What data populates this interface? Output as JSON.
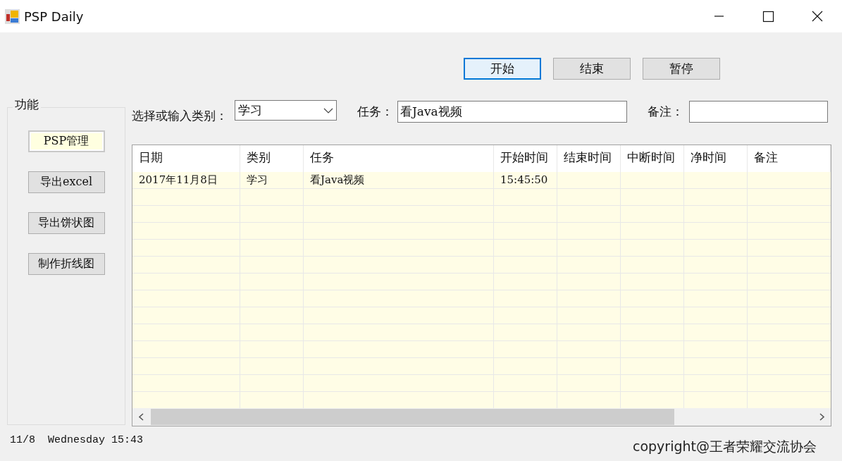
{
  "window": {
    "title": "PSP Daily"
  },
  "toolbar_buttons": [
    {
      "label": "开始",
      "focused": true
    },
    {
      "label": "结束",
      "focused": false
    },
    {
      "label": "暂停",
      "focused": false
    }
  ],
  "function_group": {
    "title": "功能",
    "buttons": [
      {
        "label": "PSP管理",
        "selected": true
      },
      {
        "label": "导出excel",
        "selected": false
      },
      {
        "label": "导出饼状图",
        "selected": false
      },
      {
        "label": "制作折线图",
        "selected": false
      }
    ]
  },
  "form": {
    "category": {
      "label": "选择或输入类别：",
      "value": "学习"
    },
    "task": {
      "label": "任务：",
      "value": "看Java视频"
    },
    "remark": {
      "label": "备注："
    }
  },
  "table": {
    "columns": [
      "日期",
      "类别",
      "任务",
      "开始时间",
      "结束时间",
      "中断时间",
      "净时间",
      "备注"
    ],
    "rows": [
      {
        "cells": [
          "2017年11月8日",
          "学习",
          "看Java视频",
          "15:45:50"
        ]
      }
    ]
  },
  "status_bar": {
    "datetime": "11/8  Wednesday 15:43",
    "copyright": "copyright@王者荣耀交流协会"
  }
}
